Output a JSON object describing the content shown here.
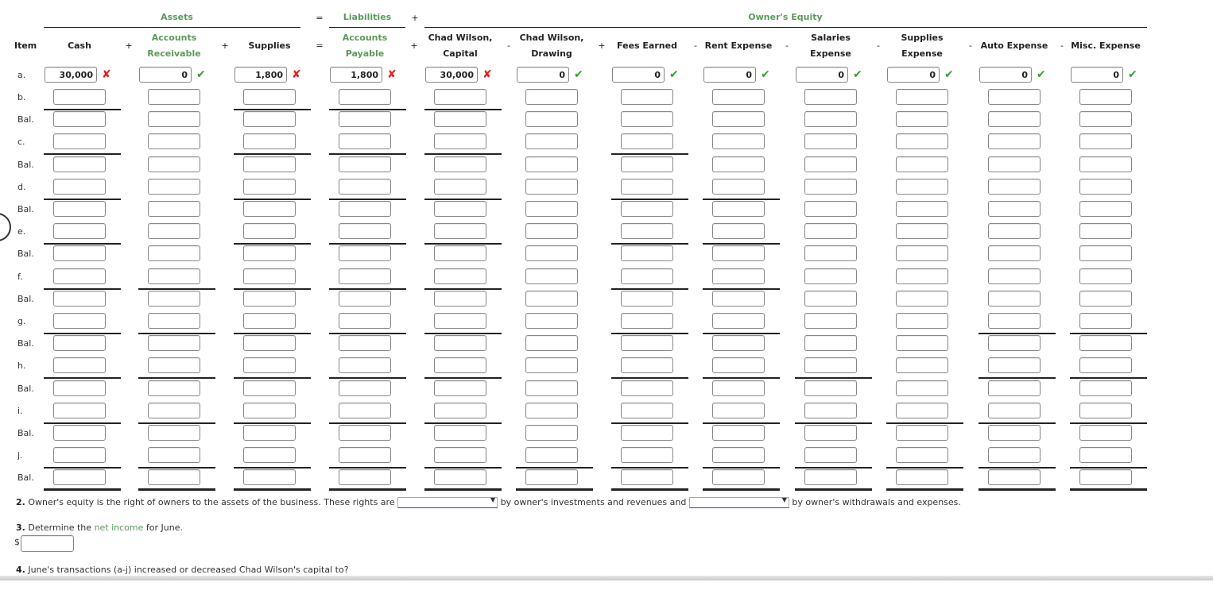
{
  "header": {
    "groups": {
      "assets": "Assets",
      "equals": "=",
      "liabilities": "Liabilities",
      "plus": "+",
      "owners_equity": "Owner's Equity"
    },
    "item_label": "Item",
    "columns": [
      {
        "key": "cash",
        "line1": "",
        "line2": "Cash",
        "green": false,
        "op_before": ""
      },
      {
        "key": "ar",
        "line1": "Accounts",
        "line2": "Receivable",
        "green": true,
        "op_before": "+"
      },
      {
        "key": "supplies",
        "line1": "",
        "line2": "Supplies",
        "green": false,
        "op_before": "+"
      },
      {
        "key": "ap",
        "line1": "Accounts",
        "line2": "Payable",
        "green": true,
        "op_before": "="
      },
      {
        "key": "capital",
        "line1": "Chad Wilson,",
        "line2": "Capital",
        "green": false,
        "op_before": "+"
      },
      {
        "key": "drawing",
        "line1": "Chad Wilson,",
        "line2": "Drawing",
        "green": false,
        "op_before": "-"
      },
      {
        "key": "fees",
        "line1": "",
        "line2": "Fees Earned",
        "green": false,
        "op_before": "+"
      },
      {
        "key": "rent",
        "line1": "",
        "line2": "Rent Expense",
        "green": false,
        "op_before": "-"
      },
      {
        "key": "salaries",
        "line1": "Salaries",
        "line2": "Expense",
        "green": false,
        "op_before": "-"
      },
      {
        "key": "supexp",
        "line1": "Supplies",
        "line2": "Expense",
        "green": false,
        "op_before": "-"
      },
      {
        "key": "auto",
        "line1": "",
        "line2": "Auto Expense",
        "green": false,
        "op_before": "-"
      },
      {
        "key": "misc",
        "line1": "",
        "line2": "Misc. Expense",
        "green": false,
        "op_before": "-"
      }
    ]
  },
  "rows": [
    {
      "label": "a.",
      "values": [
        "30,000",
        "0",
        "1,800",
        "1,800",
        "30,000",
        "0",
        "0",
        "0",
        "0",
        "0",
        "0",
        "0"
      ],
      "feedback": [
        "incorrect",
        "correct",
        "incorrect",
        "incorrect",
        "incorrect",
        "correct",
        "correct",
        "correct",
        "correct",
        "correct",
        "correct",
        "correct"
      ],
      "underline": []
    },
    {
      "label": "b.",
      "values": [
        "",
        "",
        "",
        "",
        "",
        "",
        "",
        "",
        "",
        "",
        "",
        ""
      ],
      "underline": [
        0,
        2,
        3,
        4
      ]
    },
    {
      "label": "Bal.",
      "values": [
        "",
        "",
        "",
        "",
        "",
        "",
        "",
        "",
        "",
        "",
        "",
        ""
      ],
      "underline": []
    },
    {
      "label": "c.",
      "values": [
        "",
        "",
        "",
        "",
        "",
        "",
        "",
        "",
        "",
        "",
        "",
        ""
      ],
      "underline": [
        0,
        2,
        3,
        4,
        6
      ]
    },
    {
      "label": "Bal.",
      "values": [
        "",
        "",
        "",
        "",
        "",
        "",
        "",
        "",
        "",
        "",
        "",
        ""
      ],
      "underline": []
    },
    {
      "label": "d.",
      "values": [
        "",
        "",
        "",
        "",
        "",
        "",
        "",
        "",
        "",
        "",
        "",
        ""
      ],
      "underline": [
        0,
        2,
        3,
        4,
        6,
        7
      ]
    },
    {
      "label": "Bal.",
      "values": [
        "",
        "",
        "",
        "",
        "",
        "",
        "",
        "",
        "",
        "",
        "",
        ""
      ],
      "underline": []
    },
    {
      "label": "e.",
      "values": [
        "",
        "",
        "",
        "",
        "",
        "",
        "",
        "",
        "",
        "",
        "",
        ""
      ],
      "underline": [
        0,
        2,
        3,
        4,
        6,
        7
      ]
    },
    {
      "label": "Bal.",
      "values": [
        "",
        "",
        "",
        "",
        "",
        "",
        "",
        "",
        "",
        "",
        "",
        ""
      ],
      "underline": []
    },
    {
      "label": "f.",
      "values": [
        "",
        "",
        "",
        "",
        "",
        "",
        "",
        "",
        "",
        "",
        "",
        ""
      ],
      "underline": [
        0,
        1,
        2,
        3,
        4,
        6,
        7
      ]
    },
    {
      "label": "Bal.",
      "values": [
        "",
        "",
        "",
        "",
        "",
        "",
        "",
        "",
        "",
        "",
        "",
        ""
      ],
      "underline": []
    },
    {
      "label": "g.",
      "values": [
        "",
        "",
        "",
        "",
        "",
        "",
        "",
        "",
        "",
        "",
        "",
        ""
      ],
      "underline": [
        0,
        1,
        2,
        3,
        4,
        6,
        7,
        10,
        11
      ]
    },
    {
      "label": "Bal.",
      "values": [
        "",
        "",
        "",
        "",
        "",
        "",
        "",
        "",
        "",
        "",
        "",
        ""
      ],
      "underline": []
    },
    {
      "label": "h.",
      "values": [
        "",
        "",
        "",
        "",
        "",
        "",
        "",
        "",
        "",
        "",
        "",
        ""
      ],
      "underline": [
        0,
        1,
        2,
        3,
        4,
        6,
        7,
        8,
        10,
        11
      ]
    },
    {
      "label": "Bal.",
      "values": [
        "",
        "",
        "",
        "",
        "",
        "",
        "",
        "",
        "",
        "",
        "",
        ""
      ],
      "underline": []
    },
    {
      "label": "i.",
      "values": [
        "",
        "",
        "",
        "",
        "",
        "",
        "",
        "",
        "",
        "",
        "",
        ""
      ],
      "underline": [
        0,
        1,
        2,
        3,
        4,
        6,
        7,
        8,
        9,
        10,
        11
      ]
    },
    {
      "label": "Bal.",
      "values": [
        "",
        "",
        "",
        "",
        "",
        "",
        "",
        "",
        "",
        "",
        "",
        ""
      ],
      "underline": []
    },
    {
      "label": "j.",
      "values": [
        "",
        "",
        "",
        "",
        "",
        "",
        "",
        "",
        "",
        "",
        "",
        ""
      ],
      "underline": [
        0,
        1,
        2,
        3,
        4,
        5,
        6,
        7,
        8,
        9,
        10,
        11
      ]
    },
    {
      "label": "Bal.",
      "values": [
        "",
        "",
        "",
        "",
        "",
        "",
        "",
        "",
        "",
        "",
        "",
        ""
      ],
      "underline": [
        0,
        1,
        2,
        3,
        4,
        5,
        6,
        7,
        8,
        9,
        10,
        11
      ],
      "final": true
    }
  ],
  "icons": {
    "incorrect": "✘",
    "correct": "✔"
  },
  "questions": {
    "q2": {
      "num": "2.",
      "text_before": "Owner's equity is the right of owners to the assets of the business. These rights are",
      "select1_value": "",
      "text_middle": "by owner's investments and revenues and",
      "select2_value": "",
      "text_after": "by owner's withdrawals and expenses."
    },
    "q3": {
      "num": "3.",
      "text_before": "Determine the",
      "link": "net income",
      "text_after": "for June.",
      "currency": "$",
      "answer": ""
    },
    "q4": {
      "num": "4.",
      "text": "June's transactions (a-j) increased or decreased Chad Wilson's capital to?"
    }
  }
}
